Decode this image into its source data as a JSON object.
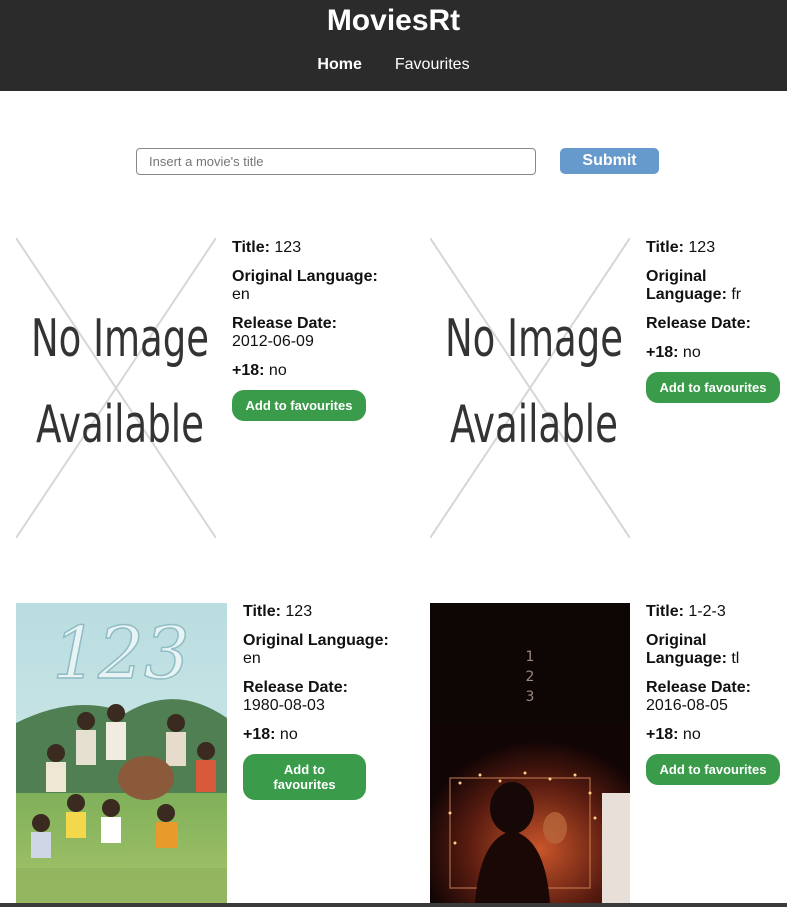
{
  "app": {
    "title": "MoviesRt"
  },
  "nav": {
    "home": "Home",
    "favourites": "Favourites"
  },
  "search": {
    "placeholder": "Insert a movie's title",
    "value": "",
    "submit_label": "Submit"
  },
  "labels": {
    "title": "Title:",
    "original_language": "Original Language:",
    "release_date": "Release Date:",
    "adult": "+18:",
    "no_image_line1": "No Image",
    "no_image_line2": "Available"
  },
  "movies": [
    {
      "title": "123",
      "original_language": "en",
      "release_date": "2012-06-09",
      "adult": "no",
      "button": "Add to favourites"
    },
    {
      "title": "123",
      "original_language": "fr",
      "release_date": "",
      "adult": "no",
      "button": "Add to favourites"
    },
    {
      "title": "123",
      "original_language": "en",
      "release_date": "1980-08-03",
      "adult": "no",
      "button": "Add to favourites"
    },
    {
      "title": "1-2-3",
      "original_language": "tl",
      "release_date": "2016-08-05",
      "adult": "no",
      "button": "Add to favourites"
    }
  ],
  "posters": {
    "poster3_text": "123",
    "poster4_text": "1\n2\n3"
  }
}
